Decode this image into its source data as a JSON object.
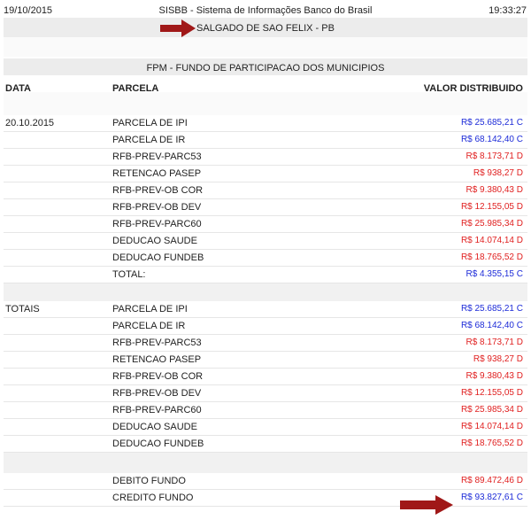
{
  "header": {
    "date": "19/10/2015",
    "title": "SISBB - Sistema de Informações Banco do Brasil",
    "time": "19:33:27"
  },
  "municipality": "SALGADO DE SAO FELIX - PB",
  "table_title": "FPM - FUNDO DE PARTICIPACAO DOS MUNICIPIOS",
  "columns": {
    "data": "DATA",
    "parcela": "PARCELA",
    "valor": "VALOR DISTRIBUIDO"
  },
  "section_date": {
    "date": "20.10.2015",
    "rows": [
      {
        "parcela": "PARCELA DE IPI",
        "valor": "R$ 25.685,21 C",
        "type": "C"
      },
      {
        "parcela": "PARCELA DE IR",
        "valor": "R$ 68.142,40 C",
        "type": "C"
      },
      {
        "parcela": "RFB-PREV-PARC53",
        "valor": "R$ 8.173,71 D",
        "type": "D"
      },
      {
        "parcela": "RETENCAO PASEP",
        "valor": "R$ 938,27 D",
        "type": "D"
      },
      {
        "parcela": "RFB-PREV-OB COR",
        "valor": "R$ 9.380,43 D",
        "type": "D"
      },
      {
        "parcela": "RFB-PREV-OB DEV",
        "valor": "R$ 12.155,05 D",
        "type": "D"
      },
      {
        "parcela": "RFB-PREV-PARC60",
        "valor": "R$ 25.985,34 D",
        "type": "D"
      },
      {
        "parcela": "DEDUCAO SAUDE",
        "valor": "R$ 14.074,14 D",
        "type": "D"
      },
      {
        "parcela": "DEDUCAO FUNDEB",
        "valor": "R$ 18.765,52 D",
        "type": "D"
      },
      {
        "parcela": "TOTAL:",
        "valor": "R$ 4.355,15 C",
        "type": "C"
      }
    ]
  },
  "section_totais": {
    "label": "TOTAIS",
    "rows": [
      {
        "parcela": "PARCELA DE IPI",
        "valor": "R$ 25.685,21 C",
        "type": "C"
      },
      {
        "parcela": "PARCELA DE IR",
        "valor": "R$ 68.142,40 C",
        "type": "C"
      },
      {
        "parcela": "RFB-PREV-PARC53",
        "valor": "R$ 8.173,71 D",
        "type": "D"
      },
      {
        "parcela": "RETENCAO PASEP",
        "valor": "R$ 938,27 D",
        "type": "D"
      },
      {
        "parcela": "RFB-PREV-OB COR",
        "valor": "R$ 9.380,43 D",
        "type": "D"
      },
      {
        "parcela": "RFB-PREV-OB DEV",
        "valor": "R$ 12.155,05 D",
        "type": "D"
      },
      {
        "parcela": "RFB-PREV-PARC60",
        "valor": "R$ 25.985,34 D",
        "type": "D"
      },
      {
        "parcela": "DEDUCAO SAUDE",
        "valor": "R$ 14.074,14 D",
        "type": "D"
      },
      {
        "parcela": "DEDUCAO FUNDEB",
        "valor": "R$ 18.765,52 D",
        "type": "D"
      }
    ]
  },
  "section_fundo": {
    "rows": [
      {
        "parcela": "DEBITO FUNDO",
        "valor": "R$ 89.472,46 D",
        "type": "D"
      },
      {
        "parcela": "CREDITO FUNDO",
        "valor": "R$ 93.827,61 C",
        "type": "C"
      }
    ]
  },
  "colors": {
    "credit": "#1d2bd8",
    "debit": "#e01f1f",
    "arrow": "#a01818",
    "band": "#ececec"
  },
  "icons": {
    "annotation_arrow": "arrow-right-icon"
  }
}
